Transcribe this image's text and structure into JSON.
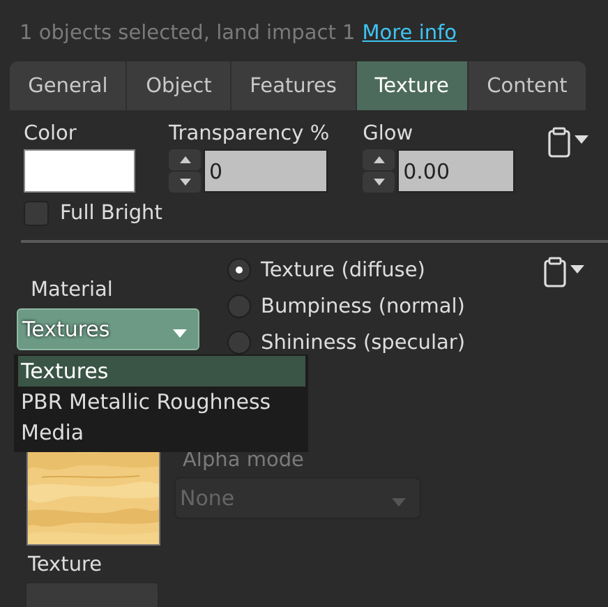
{
  "header": {
    "summary": "1 objects selected, land impact 1",
    "link": "More info"
  },
  "tabs": [
    {
      "label": "General",
      "selected": false
    },
    {
      "label": "Object",
      "selected": false
    },
    {
      "label": "Features",
      "selected": false
    },
    {
      "label": "Texture",
      "selected": true
    },
    {
      "label": "Content",
      "selected": false
    }
  ],
  "color": {
    "label": "Color",
    "color": "#ffffff"
  },
  "transparency": {
    "label": "Transparency %",
    "value": "0"
  },
  "glow": {
    "label": "Glow",
    "value": "0.00"
  },
  "full_bright": {
    "label": "Full Bright",
    "checked": false
  },
  "material": {
    "label": "Material",
    "value": "Textures",
    "expanded": true,
    "options": [
      {
        "label": "Textures",
        "selected": true
      },
      {
        "label": "PBR Metallic Roughness",
        "selected": false
      },
      {
        "label": "Media",
        "selected": false
      }
    ]
  },
  "maps": [
    {
      "label": "Texture (diffuse)",
      "selected": true
    },
    {
      "label": "Bumpiness (normal)",
      "selected": false
    },
    {
      "label": "Shininess (specular)",
      "selected": false
    }
  ],
  "alpha_mode": {
    "label": "Alpha mode",
    "value": "None",
    "disabled": true
  },
  "texture": {
    "label": "Texture"
  }
}
